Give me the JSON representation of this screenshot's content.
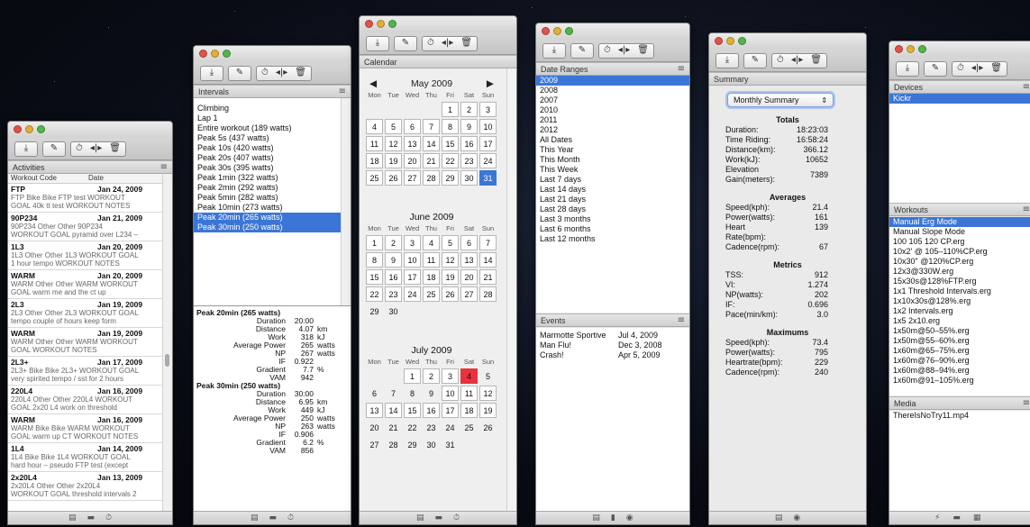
{
  "toolbar": {
    "icons": [
      "download-icon",
      "edit-icon",
      "stopwatch-icon",
      "split-icon",
      "trash-icon"
    ],
    "glyphs": {
      "download": "⤓",
      "edit": "✎",
      "stopwatch": "⏱",
      "split": "◂|▸",
      "trash": "🗑"
    }
  },
  "footer_glyphs": {
    "table": "▤",
    "folder": "▬",
    "stopwatch": "⏱",
    "bookmark": "▮",
    "dial": "◉",
    "lightning": "⚡",
    "film": "▦"
  },
  "activities": {
    "header": "Activities",
    "col_code": "Workout Code",
    "col_date": "Date",
    "items": [
      {
        "code": "FTP",
        "date": "Jan 24, 2009",
        "desc1": "FTP Bike Bike FTP test WORKOUT",
        "desc2": "GOAL 40k tt test  WORKOUT NOTES"
      },
      {
        "code": "90P234",
        "date": "Jan 21, 2009",
        "desc1": "90P234 Other Other 90P234",
        "desc2": "WORKOUT GOAL pyramid over L234 –"
      },
      {
        "code": "1L3",
        "date": "Jan 20, 2009",
        "desc1": "1L3 Other Other 1L3 WORKOUT GOAL",
        "desc2": "1 hour tempo WORKOUT NOTES"
      },
      {
        "code": "WARM",
        "date": "Jan 20, 2009",
        "desc1": "WARM Other Other WARM WORKOUT",
        "desc2": "GOAL warm me and the ct up"
      },
      {
        "code": "2L3",
        "date": "Jan 19, 2009",
        "desc1": "2L3 Other Other 2L3 WORKOUT GOAL",
        "desc2": "tempo couple of hours keep form"
      },
      {
        "code": "WARM",
        "date": "Jan 19, 2009",
        "desc1": "WARM Other Other WARM WORKOUT",
        "desc2": "GOAL  WORKOUT NOTES"
      },
      {
        "code": "2L3+",
        "date": "Jan 17, 2009",
        "desc1": "2L3+ Bike Bike 2L3+ WORKOUT GOAL",
        "desc2": "very spirited tempo / sst for 2 hours"
      },
      {
        "code": "220L4",
        "date": "Jan 16, 2009",
        "desc1": "220L4 Other Other 220L4 WORKOUT",
        "desc2": "GOAL 2x20 L4 work on threshold"
      },
      {
        "code": "WARM",
        "date": "Jan 16, 2009",
        "desc1": "WARM Bike Bike WARM WORKOUT",
        "desc2": "GOAL warm up CT WORKOUT NOTES"
      },
      {
        "code": "1L4",
        "date": "Jan 14, 2009",
        "desc1": "1L4 Bike Bike 1L4 WORKOUT GOAL",
        "desc2": "hard hour – pseudo FTP test (except"
      },
      {
        "code": "2x20L4",
        "date": "Jan 13, 2009",
        "desc1": "2x20L4 Other Other 2x20L4",
        "desc2": "WORKOUT GOAL threshold intervals 2"
      }
    ]
  },
  "intervals": {
    "header": "Intervals",
    "items": [
      {
        "label": "Climbing",
        "selected": false
      },
      {
        "label": "Lap 1",
        "selected": false
      },
      {
        "label": "Entire workout (189 watts)",
        "selected": false
      },
      {
        "label": "Peak 5s (437 watts)",
        "selected": false
      },
      {
        "label": "Peak 10s (420 watts)",
        "selected": false
      },
      {
        "label": "Peak 20s (407 watts)",
        "selected": false
      },
      {
        "label": "Peak 30s (395 watts)",
        "selected": false
      },
      {
        "label": "Peak 1min (322 watts)",
        "selected": false
      },
      {
        "label": "Peak 2min (292 watts)",
        "selected": false
      },
      {
        "label": "Peak 5min (282 watts)",
        "selected": false
      },
      {
        "label": "Peak 10min (273 watts)",
        "selected": false
      },
      {
        "label": "Peak 20min (265 watts)",
        "selected": true
      },
      {
        "label": "Peak 30min (250 watts)",
        "selected": true
      }
    ],
    "details": [
      {
        "title": "Peak 20min (265 watts)",
        "rows": [
          {
            "label": "Duration",
            "value": "20:00",
            "unit": ""
          },
          {
            "label": "Distance",
            "value": "4.07",
            "unit": "km"
          },
          {
            "label": "Work",
            "value": "318",
            "unit": "kJ"
          },
          {
            "label": "Average Power",
            "value": "265",
            "unit": "watts"
          },
          {
            "label": "NP",
            "value": "267",
            "unit": "watts"
          },
          {
            "label": "IF",
            "value": "0.922",
            "unit": ""
          },
          {
            "label": "Gradient",
            "value": "7.7",
            "unit": "%"
          },
          {
            "label": "VAM",
            "value": "942",
            "unit": ""
          }
        ]
      },
      {
        "title": "Peak 30min (250 watts)",
        "rows": [
          {
            "label": "Duration",
            "value": "30:00",
            "unit": ""
          },
          {
            "label": "Distance",
            "value": "6.95",
            "unit": "km"
          },
          {
            "label": "Work",
            "value": "449",
            "unit": "kJ"
          },
          {
            "label": "Average Power",
            "value": "250",
            "unit": "watts"
          },
          {
            "label": "NP",
            "value": "263",
            "unit": "watts"
          },
          {
            "label": "IF",
            "value": "0.906",
            "unit": ""
          },
          {
            "label": "Gradient",
            "value": "6.2",
            "unit": "%"
          },
          {
            "label": "VAM",
            "value": "856",
            "unit": ""
          }
        ]
      }
    ]
  },
  "calendar": {
    "header": "Calendar",
    "prev": "◀",
    "next": "▶",
    "dow": [
      "Mon",
      "Tue",
      "Wed",
      "Thu",
      "Fri",
      "Sat",
      "Sun"
    ],
    "months": [
      {
        "title": "May 2009",
        "offset": 4,
        "days": 31,
        "selected": [
          31
        ],
        "red": [],
        "boxed": [
          1,
          2,
          3,
          4,
          5,
          6,
          7,
          8,
          9,
          10,
          11,
          12,
          13,
          14,
          15,
          16,
          17,
          18,
          19,
          20,
          21,
          22,
          23,
          24,
          25,
          26,
          27,
          28,
          29,
          30,
          31
        ]
      },
      {
        "title": "June 2009",
        "offset": 0,
        "days": 30,
        "selected": [],
        "red": [],
        "boxed": [
          1,
          2,
          3,
          4,
          5,
          6,
          7,
          8,
          9,
          10,
          11,
          12,
          13,
          14,
          15,
          16,
          17,
          18,
          19,
          20,
          21,
          22,
          23,
          24,
          25,
          26,
          27,
          28
        ]
      },
      {
        "title": "July 2009",
        "offset": 2,
        "days": 31,
        "selected": [],
        "red": [
          4
        ],
        "boxed": [
          1,
          2,
          3,
          4,
          10,
          11,
          12,
          13,
          14,
          15,
          16,
          17,
          18,
          19
        ]
      }
    ]
  },
  "date_ranges": {
    "header": "Date Ranges",
    "items": [
      {
        "label": "2009",
        "selected": true
      },
      {
        "label": "2008",
        "selected": false
      },
      {
        "label": "2007",
        "selected": false
      },
      {
        "label": "2010",
        "selected": false
      },
      {
        "label": "2011",
        "selected": false
      },
      {
        "label": "2012",
        "selected": false
      },
      {
        "label": "All Dates",
        "selected": false
      },
      {
        "label": "This Year",
        "selected": false
      },
      {
        "label": "This Month",
        "selected": false
      },
      {
        "label": "This Week",
        "selected": false
      },
      {
        "label": "Last 7 days",
        "selected": false
      },
      {
        "label": "Last 14 days",
        "selected": false
      },
      {
        "label": "Last 21 days",
        "selected": false
      },
      {
        "label": "Last 28 days",
        "selected": false
      },
      {
        "label": "Last 3 months",
        "selected": false
      },
      {
        "label": "Last 6 months",
        "selected": false
      },
      {
        "label": "Last 12 months",
        "selected": false
      }
    ]
  },
  "events": {
    "header": "Events",
    "items": [
      {
        "name": "Marmotte Sportive",
        "date": "Jul 4, 2009"
      },
      {
        "name": "Man Flu!",
        "date": "Dec 3, 2008"
      },
      {
        "name": "Crash!",
        "date": "Apr 5, 2009"
      }
    ]
  },
  "summary": {
    "header": "Summary",
    "select_value": "Monthly Summary",
    "sections": [
      {
        "title": "Totals",
        "rows": [
          {
            "label": "Duration:",
            "value": "18:23:03"
          },
          {
            "label": "Time Riding:",
            "value": "16:58:24"
          },
          {
            "label": "Distance(km):",
            "value": "366.12"
          },
          {
            "label": "Work(kJ):",
            "value": "10652"
          },
          {
            "label": "Elevation Gain(meters):",
            "value": "7389"
          }
        ]
      },
      {
        "title": "Averages",
        "rows": [
          {
            "label": "Speed(kph):",
            "value": "21.4"
          },
          {
            "label": "Power(watts):",
            "value": "161"
          },
          {
            "label": "Heart Rate(bpm):",
            "value": "139"
          },
          {
            "label": "Cadence(rpm):",
            "value": "67"
          }
        ]
      },
      {
        "title": "Metrics",
        "rows": [
          {
            "label": "TSS:",
            "value": "912"
          },
          {
            "label": "VI:",
            "value": "1.274"
          },
          {
            "label": "NP(watts):",
            "value": "202"
          },
          {
            "label": "IF:",
            "value": "0.696"
          },
          {
            "label": "Pace(min/km):",
            "value": "3.0"
          }
        ]
      },
      {
        "title": "Maximums",
        "rows": [
          {
            "label": "Speed(kph):",
            "value": "73.4"
          },
          {
            "label": "Power(watts):",
            "value": "795"
          },
          {
            "label": "Heartrate(bpm):",
            "value": "229"
          },
          {
            "label": "Cadence(rpm):",
            "value": "240"
          }
        ]
      }
    ]
  },
  "devices": {
    "header": "Devices",
    "items": [
      {
        "label": "Kickr",
        "selected": true
      }
    ],
    "workouts_header": "Workouts",
    "workouts": [
      {
        "label": "Manual Erg Mode",
        "selected": true
      },
      {
        "label": "Manual Slope Mode",
        "selected": false
      },
      {
        "label": "100 105 120 CP.erg",
        "selected": false
      },
      {
        "label": "10x2' @ 105–110%CP.erg",
        "selected": false
      },
      {
        "label": "10x30\" @120%CP.erg",
        "selected": false
      },
      {
        "label": "12x3@330W.erg",
        "selected": false
      },
      {
        "label": "15x30s@128%FTP.erg",
        "selected": false
      },
      {
        "label": "1x1 Threshold Intervals.erg",
        "selected": false
      },
      {
        "label": "1x10x30s@128%.erg",
        "selected": false
      },
      {
        "label": "1x2 Intervals.erg",
        "selected": false
      },
      {
        "label": "1x5 2x10.erg",
        "selected": false
      },
      {
        "label": "1x50m@50–55%.erg",
        "selected": false
      },
      {
        "label": "1x50m@55–60%.erg",
        "selected": false
      },
      {
        "label": "1x60m@65–75%.erg",
        "selected": false
      },
      {
        "label": "1x60m@76–90%.erg",
        "selected": false
      },
      {
        "label": "1x60m@88–94%.erg",
        "selected": false
      },
      {
        "label": "1x60m@91–105%.erg",
        "selected": false
      }
    ],
    "media_header": "Media",
    "media": [
      {
        "label": "ThereIsNoTry11.mp4",
        "selected": false
      }
    ]
  }
}
